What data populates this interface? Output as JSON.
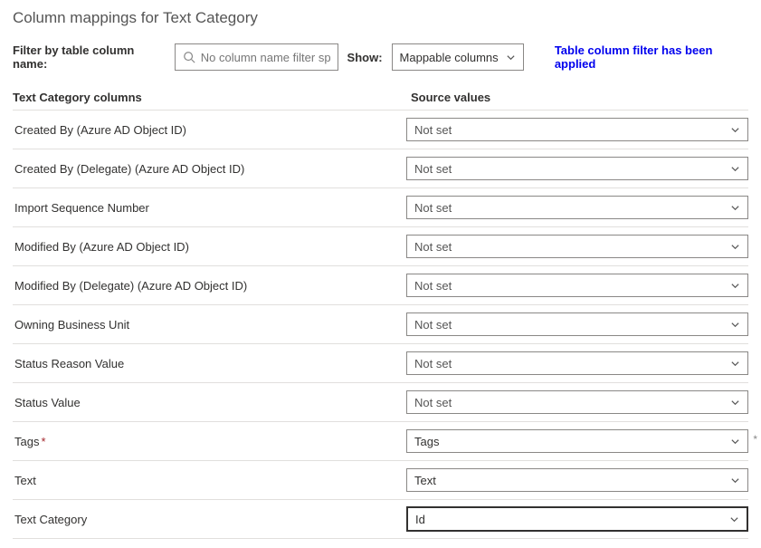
{
  "page": {
    "title": "Column mappings for Text Category"
  },
  "filter": {
    "label": "Filter by table column name:",
    "placeholder": "No column name filter sp..."
  },
  "show": {
    "label": "Show:",
    "value": "Mappable columns"
  },
  "notice": "Table column filter has been applied",
  "headers": {
    "left": "Text Category columns",
    "right": "Source values"
  },
  "rows": [
    {
      "label": "Created By (Azure AD Object ID)",
      "value": "Not set",
      "isSet": false,
      "required": false,
      "focused": false,
      "trailingMark": false
    },
    {
      "label": "Created By (Delegate) (Azure AD Object ID)",
      "value": "Not set",
      "isSet": false,
      "required": false,
      "focused": false,
      "trailingMark": false
    },
    {
      "label": "Import Sequence Number",
      "value": "Not set",
      "isSet": false,
      "required": false,
      "focused": false,
      "trailingMark": false
    },
    {
      "label": "Modified By (Azure AD Object ID)",
      "value": "Not set",
      "isSet": false,
      "required": false,
      "focused": false,
      "trailingMark": false
    },
    {
      "label": "Modified By (Delegate) (Azure AD Object ID)",
      "value": "Not set",
      "isSet": false,
      "required": false,
      "focused": false,
      "trailingMark": false
    },
    {
      "label": "Owning Business Unit",
      "value": "Not set",
      "isSet": false,
      "required": false,
      "focused": false,
      "trailingMark": false
    },
    {
      "label": "Status Reason Value",
      "value": "Not set",
      "isSet": false,
      "required": false,
      "focused": false,
      "trailingMark": false
    },
    {
      "label": "Status Value",
      "value": "Not set",
      "isSet": false,
      "required": false,
      "focused": false,
      "trailingMark": false
    },
    {
      "label": "Tags",
      "value": "Tags",
      "isSet": true,
      "required": true,
      "focused": false,
      "trailingMark": true
    },
    {
      "label": "Text",
      "value": "Text",
      "isSet": true,
      "required": false,
      "focused": false,
      "trailingMark": false
    },
    {
      "label": "Text Category",
      "value": "Id",
      "isSet": true,
      "required": false,
      "focused": true,
      "trailingMark": false
    }
  ]
}
